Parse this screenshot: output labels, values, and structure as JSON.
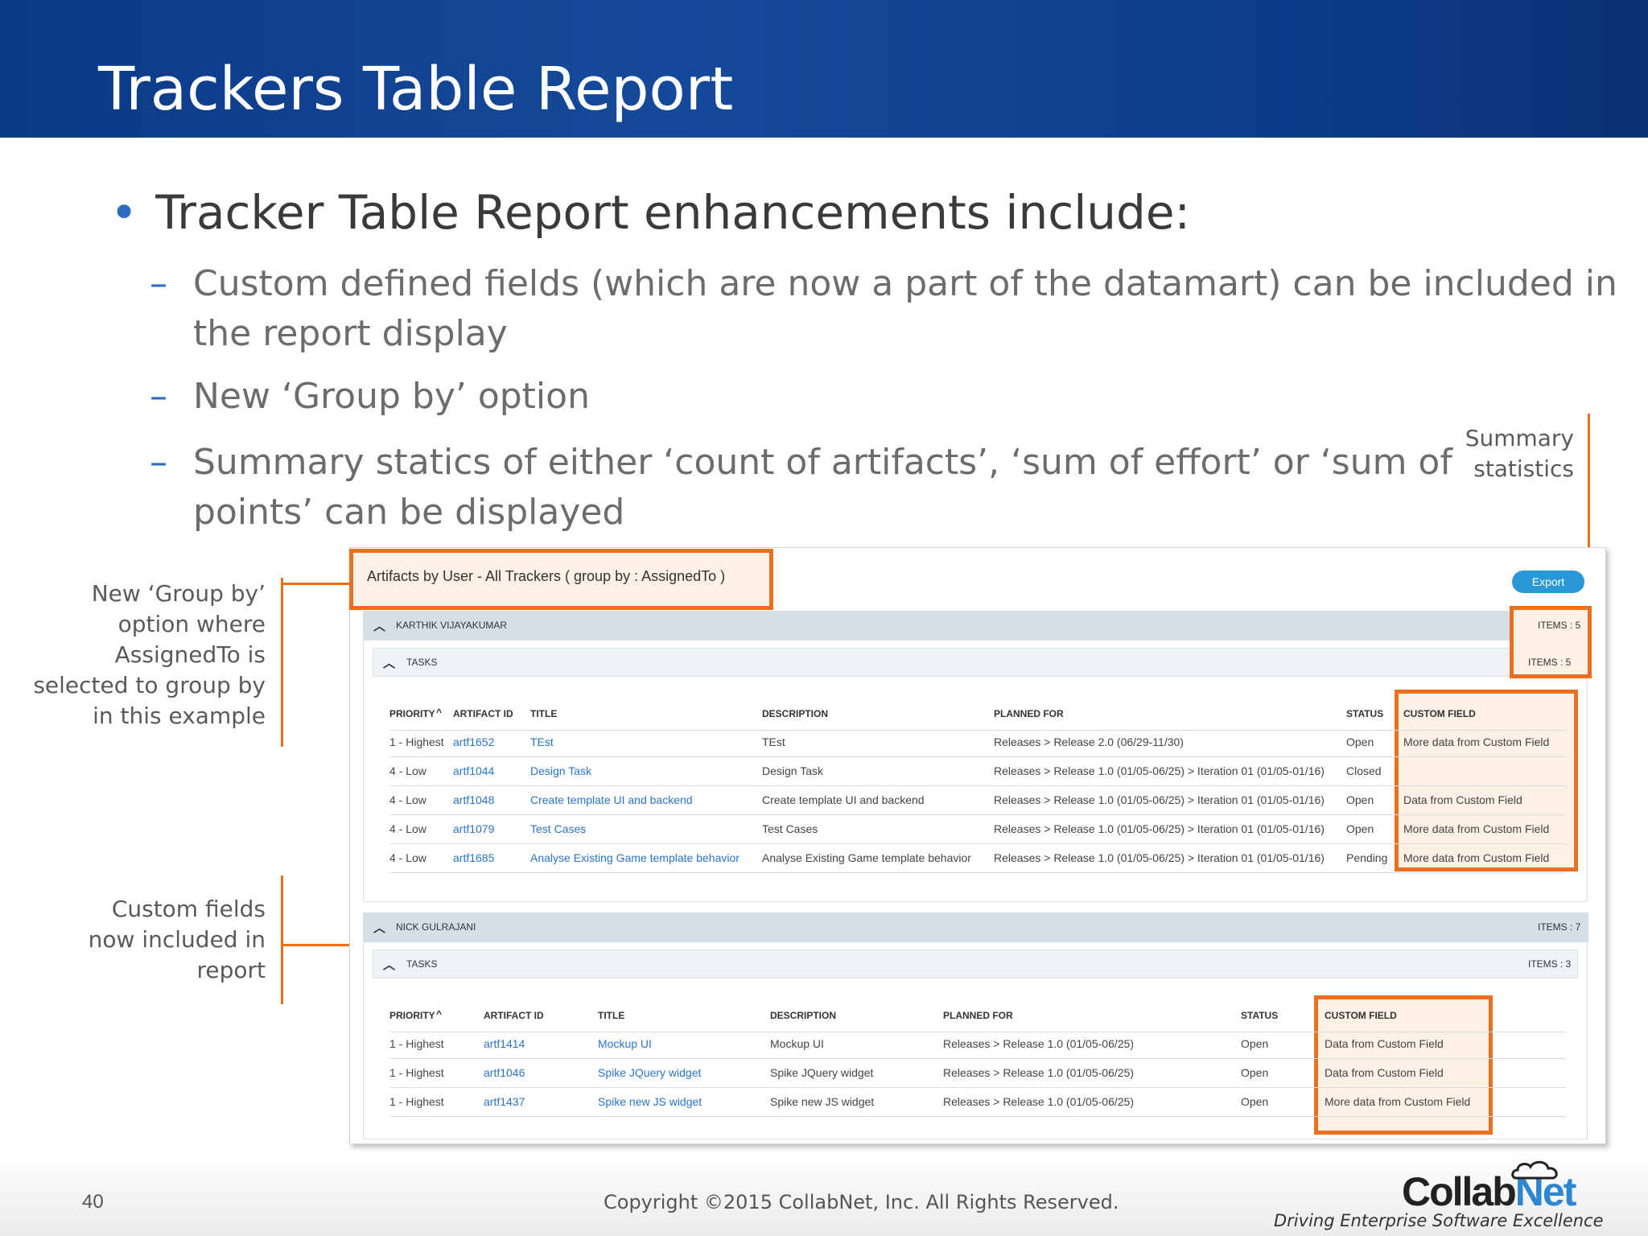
{
  "slide": {
    "title": "Trackers Table Report",
    "bullet_main": "Tracker Table Report enhancements include:",
    "bullet_symbol": "•",
    "dash": "–",
    "sub_bullets": [
      {
        "line1": "Custom defined fields (which are now a part of the datamart) can be included in",
        "line2": "the report display"
      },
      {
        "line1": "New ‘Group by’ option",
        "line2": ""
      },
      {
        "line1": "Summary statics of either ‘count of artifacts’, ‘sum of effort’ or ‘sum of",
        "line2": "points’ can be displayed"
      }
    ]
  },
  "annotations": {
    "summary": [
      "Summary",
      "statistics"
    ],
    "group_by": [
      "New ‘Group by’",
      "option where",
      "AssignedTo is",
      "selected to group by",
      "in this example"
    ],
    "custom_fields": [
      "Custom fields",
      "now included in",
      "report"
    ]
  },
  "report": {
    "title": "Artifacts by User - All Trackers ( group by : AssignedTo )",
    "export_label": "Export",
    "groups": [
      {
        "name": "KARTHIK VIJAYAKUMAR",
        "items": "ITEMS : 5",
        "task_label": "TASKS",
        "task_items": "ITEMS : 5",
        "columns": [
          "PRIORITY",
          "ARTIFACT ID",
          "TITLE",
          "DESCRIPTION",
          "PLANNED FOR",
          "STATUS",
          "CUSTOM FIELD"
        ],
        "rows": [
          [
            "1 - Highest",
            "artf1652",
            "TEst",
            "TEst",
            "Releases > Release 2.0 (06/29-11/30)",
            "Open",
            "More data from Custom Field"
          ],
          [
            "4 - Low",
            "artf1044",
            "Design Task",
            "Design Task",
            "Releases > Release 1.0 (01/05-06/25) > Iteration 01 (01/05-01/16)",
            "Closed",
            ""
          ],
          [
            "4 - Low",
            "artf1048",
            "Create template UI and backend",
            "Create template UI and backend",
            "Releases > Release 1.0 (01/05-06/25) > Iteration 01 (01/05-01/16)",
            "Open",
            "Data from Custom Field"
          ],
          [
            "4 - Low",
            "artf1079",
            "Test Cases",
            "Test Cases",
            "Releases > Release 1.0 (01/05-06/25) > Iteration 01 (01/05-01/16)",
            "Open",
            "More data from Custom Field"
          ],
          [
            "4 - Low",
            "artf1685",
            "Analyse Existing Game template behavior",
            "Analyse Existing Game template behavior",
            "Releases > Release 1.0 (01/05-06/25) > Iteration 01 (01/05-01/16)",
            "Pending",
            "More data from Custom Field"
          ]
        ]
      },
      {
        "name": "NICK GULRAJANI",
        "items": "ITEMS : 7",
        "task_label": "TASKS",
        "task_items": "ITEMS : 3",
        "columns": [
          "PRIORITY",
          "ARTIFACT ID",
          "TITLE",
          "DESCRIPTION",
          "PLANNED FOR",
          "STATUS",
          "CUSTOM FIELD"
        ],
        "rows": [
          [
            "1 - Highest",
            "artf1414",
            "Mockup UI",
            "Mockup UI",
            "Releases > Release 1.0 (01/05-06/25)",
            "Open",
            "Data from Custom Field"
          ],
          [
            "1 - Highest",
            "artf1046",
            "Spike JQuery widget",
            "Spike JQuery widget",
            "Releases > Release 1.0 (01/05-06/25)",
            "Open",
            "Data from Custom Field"
          ],
          [
            "1 - Highest",
            "artf1437",
            "Spike new JS widget",
            "Spike new JS widget",
            "Releases > Release 1.0 (01/05-06/25)",
            "Open",
            "More data from Custom Field"
          ]
        ]
      }
    ]
  },
  "footer": {
    "page_number": "40",
    "copyright": "Copyright ©2015 CollabNet, Inc. All Rights Reserved.",
    "logo_part1": "Collab",
    "logo_part2": "Net",
    "tagline": "Driving Enterprise Software Excellence"
  },
  "colors": {
    "header_blue": "#0b3a86",
    "accent_orange": "#e8701e",
    "link_blue": "#2a75c7",
    "export_blue": "#2a97d8"
  }
}
